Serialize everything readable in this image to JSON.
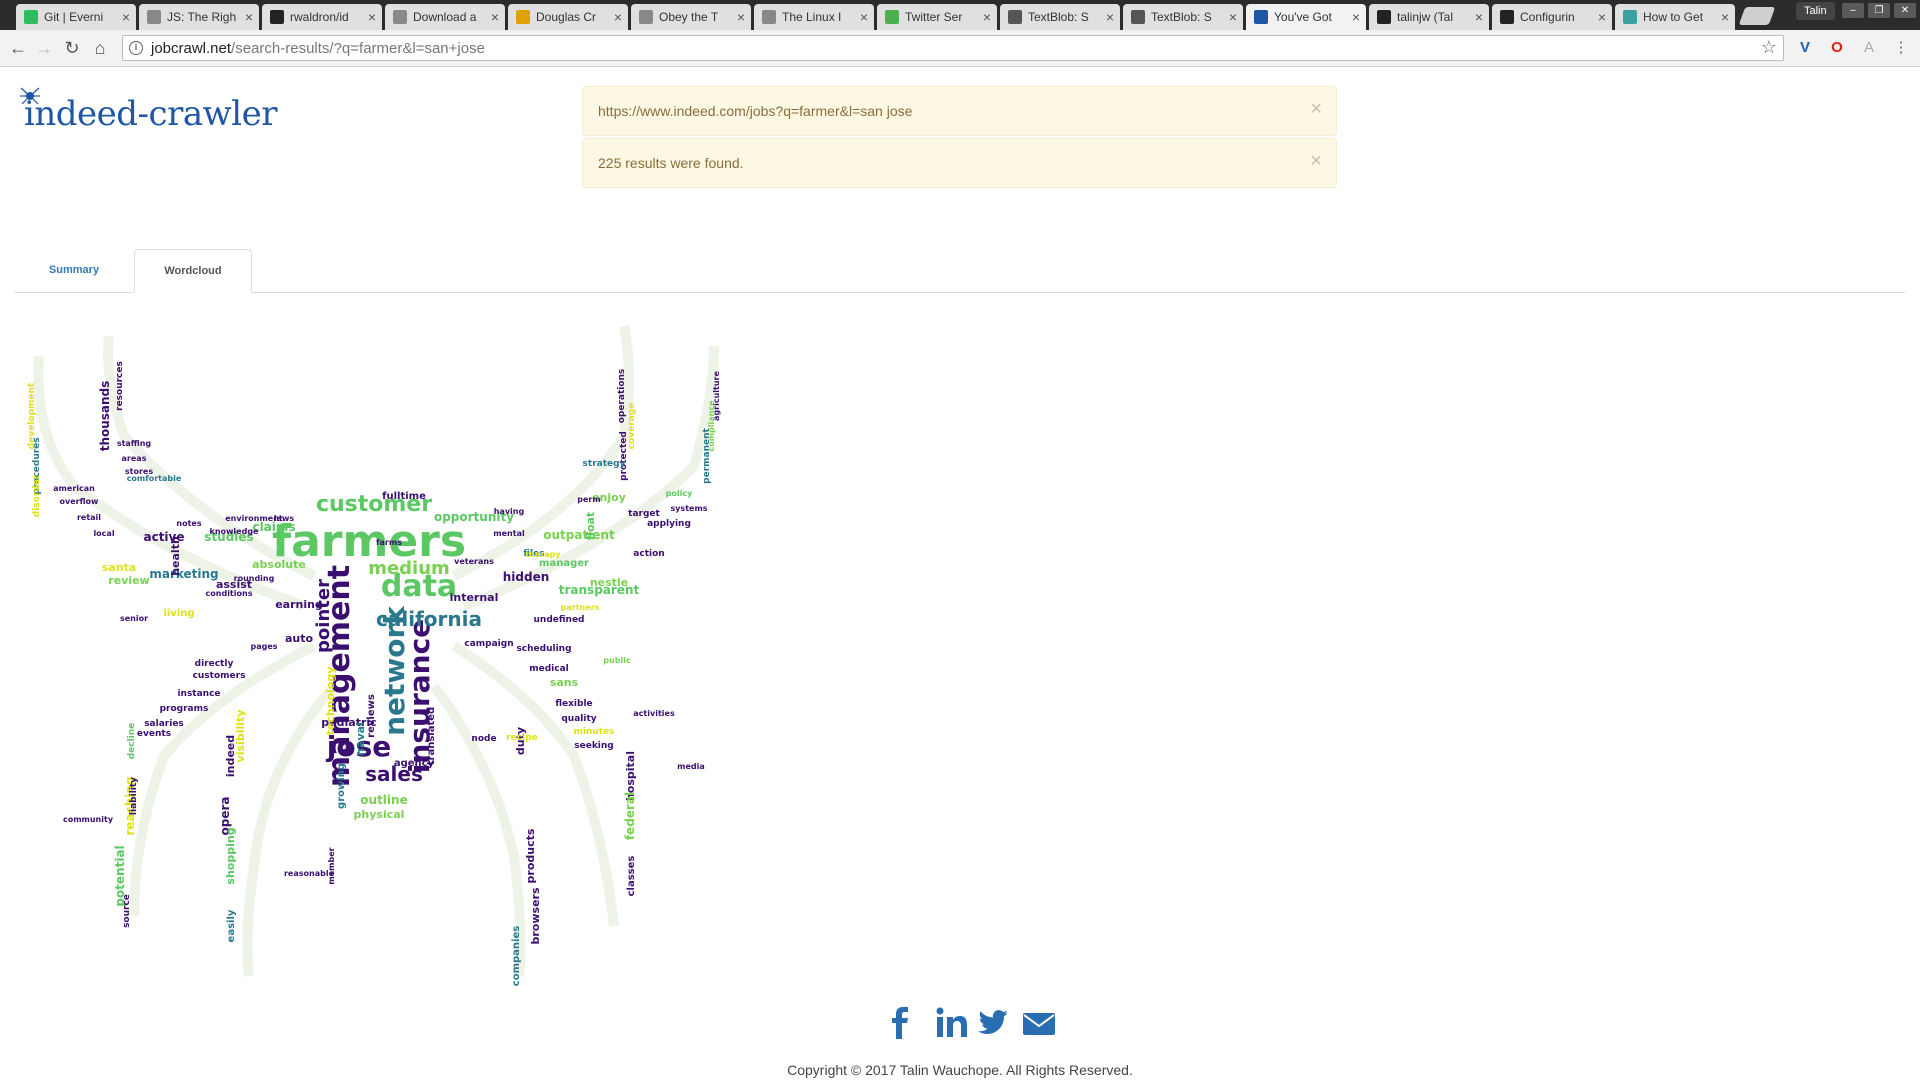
{
  "browser": {
    "tabs": [
      {
        "title": "Git | Everni",
        "icon": "evernote-icon",
        "color": "#2dbe60",
        "active": false
      },
      {
        "title": "JS: The Righ",
        "icon": "document-icon",
        "color": "#888888",
        "active": false
      },
      {
        "title": "rwaldron/id",
        "icon": "github-icon",
        "color": "#222222",
        "active": false
      },
      {
        "title": "Download a",
        "icon": "document-icon",
        "color": "#888888",
        "active": false
      },
      {
        "title": "Douglas Cr",
        "icon": "grid-icon",
        "color": "#e0a000",
        "active": false
      },
      {
        "title": "Obey the T",
        "icon": "document-icon",
        "color": "#888888",
        "active": false
      },
      {
        "title": "The Linux I",
        "icon": "document-icon",
        "color": "#888888",
        "active": false
      },
      {
        "title": "Twitter Ser",
        "icon": "dev-icon",
        "color": "#4caf50",
        "active": false
      },
      {
        "title": "TextBlob: S",
        "icon": "book-icon",
        "color": "#555555",
        "active": false
      },
      {
        "title": "TextBlob: S",
        "icon": "book-icon",
        "color": "#555555",
        "active": false
      },
      {
        "title": "You've Got",
        "icon": "spider-icon",
        "color": "#1f57a5",
        "active": true
      },
      {
        "title": "talinjw (Tal",
        "icon": "github-icon",
        "color": "#222222",
        "active": false
      },
      {
        "title": "Configurin",
        "icon": "github-icon",
        "color": "#222222",
        "active": false
      },
      {
        "title": "How to Get",
        "icon": "cc-icon",
        "color": "#3aa0a0",
        "active": false
      }
    ],
    "user": "Talin",
    "url_domain": "jobcrawl.net",
    "url_path": "/search-results/?q=farmer&l=san+jose"
  },
  "page": {
    "logo": "indeed-crawler",
    "alerts": [
      {
        "text": "https://www.indeed.com/jobs?q=farmer&l=san jose",
        "close": "×"
      },
      {
        "text": "225 results were found.",
        "close": "×"
      }
    ],
    "tabs": [
      {
        "label": "Summary",
        "active": false
      },
      {
        "label": "Wordcloud",
        "active": true
      }
    ],
    "wordcloud": {
      "words": [
        {
          "w": "farmers",
          "c": "#5cc863"
        },
        {
          "w": "data",
          "c": "#5cc863"
        },
        {
          "w": "management",
          "c": "#3b0f70"
        },
        {
          "w": "network",
          "c": "#2a788e"
        },
        {
          "w": "insurance",
          "c": "#3b0f70"
        },
        {
          "w": "jose",
          "c": "#3b0f70"
        },
        {
          "w": "california",
          "c": "#2a788e"
        },
        {
          "w": "customer",
          "c": "#5cc863"
        },
        {
          "w": "medium",
          "c": "#7ad151"
        },
        {
          "w": "pointer",
          "c": "#3b0f70"
        },
        {
          "w": "sales",
          "c": "#3b0f70"
        },
        {
          "w": "opportunity",
          "c": "#5cc863"
        },
        {
          "w": "fulltime",
          "c": "#3b0f70"
        },
        {
          "w": "transparent",
          "c": "#5cc863"
        },
        {
          "w": "outpatient",
          "c": "#7ad151"
        },
        {
          "w": "hidden",
          "c": "#3b0f70"
        },
        {
          "w": "internal",
          "c": "#3b0f70"
        },
        {
          "w": "pediatric",
          "c": "#3b0f70"
        },
        {
          "w": "naval",
          "c": "#2a788e"
        },
        {
          "w": "agency",
          "c": "#3b0f70"
        },
        {
          "w": "outline",
          "c": "#7ad151"
        },
        {
          "w": "physical",
          "c": "#7ad151"
        },
        {
          "w": "technology",
          "c": "#dde318"
        },
        {
          "w": "reviews",
          "c": "#3b0f70"
        },
        {
          "w": "translated",
          "c": "#3b0f70"
        },
        {
          "w": "claims",
          "c": "#5cc863"
        },
        {
          "w": "studies",
          "c": "#5cc863"
        },
        {
          "w": "absolute",
          "c": "#7ad151"
        },
        {
          "w": "marketing",
          "c": "#2a788e"
        },
        {
          "w": "health",
          "c": "#3b0f70"
        },
        {
          "w": "active",
          "c": "#3b0f70"
        },
        {
          "w": "review",
          "c": "#7ad151"
        },
        {
          "w": "santa",
          "c": "#dde318"
        },
        {
          "w": "living",
          "c": "#dde318"
        },
        {
          "w": "assist",
          "c": "#3b0f70"
        },
        {
          "w": "earning",
          "c": "#3b0f70"
        },
        {
          "w": "auto",
          "c": "#3b0f70"
        },
        {
          "w": "float",
          "c": "#5cc863"
        },
        {
          "w": "enjoy",
          "c": "#7ad151"
        },
        {
          "w": "nestle",
          "c": "#7ad151"
        },
        {
          "w": "manager",
          "c": "#5cc863"
        },
        {
          "w": "duty",
          "c": "#3b0f70"
        },
        {
          "w": "sans",
          "c": "#7ad151"
        },
        {
          "w": "products",
          "c": "#3b0f70"
        },
        {
          "w": "browsers",
          "c": "#3b0f70"
        },
        {
          "w": "visibility",
          "c": "#dde318"
        },
        {
          "w": "opera",
          "c": "#3b0f70"
        },
        {
          "w": "indeed",
          "c": "#3b0f70"
        },
        {
          "w": "shopping",
          "c": "#5cc863"
        },
        {
          "w": "reaching",
          "c": "#dde318"
        },
        {
          "w": "potential",
          "c": "#5cc863"
        },
        {
          "w": "thousands",
          "c": "#3b0f70"
        },
        {
          "w": "resources",
          "c": "#3b0f70"
        },
        {
          "w": "hospital",
          "c": "#3b0f70"
        },
        {
          "w": "federal",
          "c": "#7ad151"
        },
        {
          "w": "classes",
          "c": "#3b0f70"
        },
        {
          "w": "agriculture",
          "c": "#3b0f70"
        },
        {
          "w": "compliance",
          "c": "#7ad151"
        },
        {
          "w": "permanent",
          "c": "#2a788e"
        },
        {
          "w": "development",
          "c": "#dde318"
        },
        {
          "w": "procedures",
          "c": "#2a788e"
        },
        {
          "w": "disorder",
          "c": "#dde318"
        },
        {
          "w": "growing",
          "c": "#2a788e"
        },
        {
          "w": "easily",
          "c": "#2a788e"
        },
        {
          "w": "companies",
          "c": "#2a788e"
        },
        {
          "w": "operations",
          "c": "#3b0f70"
        },
        {
          "w": "coverage",
          "c": "#dde318"
        },
        {
          "w": "protected",
          "c": "#3b0f70"
        },
        {
          "w": "strategy",
          "c": "#2a788e"
        },
        {
          "w": "target",
          "c": "#3b0f70"
        },
        {
          "w": "applying",
          "c": "#3b0f70"
        },
        {
          "w": "systems",
          "c": "#3b0f70"
        },
        {
          "w": "policy",
          "c": "#5cc863"
        },
        {
          "w": "action",
          "c": "#3b0f70"
        },
        {
          "w": "files",
          "c": "#2a788e"
        },
        {
          "w": "undefined",
          "c": "#3b0f70"
        },
        {
          "w": "campaign",
          "c": "#3b0f70"
        },
        {
          "w": "scheduling",
          "c": "#3b0f70"
        },
        {
          "w": "medical",
          "c": "#3b0f70"
        },
        {
          "w": "flexible",
          "c": "#3b0f70"
        },
        {
          "w": "quality",
          "c": "#3b0f70"
        },
        {
          "w": "minutes",
          "c": "#dde318"
        },
        {
          "w": "seeking",
          "c": "#3b0f70"
        },
        {
          "w": "recipe",
          "c": "#dde318"
        },
        {
          "w": "node",
          "c": "#3b0f70"
        },
        {
          "w": "perm",
          "c": "#3b0f70"
        },
        {
          "w": "mental",
          "c": "#3b0f70"
        },
        {
          "w": "having",
          "c": "#3b0f70"
        },
        {
          "w": "farms",
          "c": "#3b0f70"
        },
        {
          "w": "veterans",
          "c": "#3b0f70"
        },
        {
          "w": "laws",
          "c": "#3b0f70"
        },
        {
          "w": "environment",
          "c": "#3b0f70"
        },
        {
          "w": "knowledge",
          "c": "#3b0f70"
        },
        {
          "w": "conditions",
          "c": "#3b0f70"
        },
        {
          "w": "pages",
          "c": "#3b0f70"
        },
        {
          "w": "directly",
          "c": "#3b0f70"
        },
        {
          "w": "customers",
          "c": "#3b0f70"
        },
        {
          "w": "instance",
          "c": "#3b0f70"
        },
        {
          "w": "programs",
          "c": "#3b0f70"
        },
        {
          "w": "salaries",
          "c": "#3b0f70"
        },
        {
          "w": "events",
          "c": "#3b0f70"
        },
        {
          "w": "decline",
          "c": "#5cc863"
        },
        {
          "w": "liability",
          "c": "#3b0f70"
        },
        {
          "w": "source",
          "c": "#3b0f70"
        },
        {
          "w": "staffing",
          "c": "#3b0f70"
        },
        {
          "w": "areas",
          "c": "#3b0f70"
        },
        {
          "w": "stores",
          "c": "#3b0f70"
        },
        {
          "w": "comfortable",
          "c": "#2a788e"
        },
        {
          "w": "american",
          "c": "#3b0f70"
        },
        {
          "w": "overflow",
          "c": "#3b0f70"
        },
        {
          "w": "retail",
          "c": "#3b0f70"
        },
        {
          "w": "local",
          "c": "#3b0f70"
        },
        {
          "w": "senior",
          "c": "#3b0f70"
        },
        {
          "w": "notes",
          "c": "#3b0f70"
        },
        {
          "w": "rounding",
          "c": "#3b0f70"
        },
        {
          "w": "member",
          "c": "#3b0f70"
        },
        {
          "w": "reasonable",
          "c": "#3b0f70"
        },
        {
          "w": "therapy",
          "c": "#dde318"
        },
        {
          "w": "partners",
          "c": "#dde318"
        },
        {
          "w": "public",
          "c": "#7ad151"
        },
        {
          "w": "activities",
          "c": "#3b0f70"
        },
        {
          "w": "media",
          "c": "#3b0f70"
        },
        {
          "w": "community",
          "c": "#3b0f70"
        }
      ]
    },
    "social": [
      {
        "name": "facebook-icon",
        "glyph": "f"
      },
      {
        "name": "linkedin-icon",
        "glyph": "in"
      },
      {
        "name": "twitter-icon",
        "glyph": "twitter"
      },
      {
        "name": "email-icon",
        "glyph": "envelope"
      }
    ],
    "accent": "#337ab7",
    "copyright": "Copyright © 2017 Talin Wauchope. All Rights Reserved."
  }
}
